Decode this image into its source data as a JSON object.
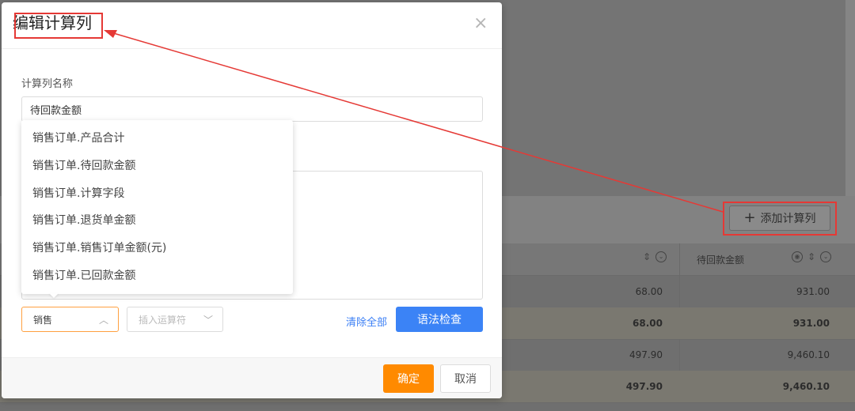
{
  "modal": {
    "title": "编辑计算列",
    "close_label": "×",
    "name_label": "计算列名称",
    "name_value": "待回款金额",
    "dropdown_items": [
      "销售订单.产品合计",
      "销售订单.待回款金额",
      "销售订单.计算字段",
      "销售订单.退货单金额",
      "销售订单.销售订单金额(元)",
      "销售订单.已回款金额"
    ],
    "select_sales": "销售",
    "select_ops_placeholder": "插入运算符",
    "clear_all": "清除全部",
    "syntax_check": "语法检查",
    "ok": "确定",
    "cancel": "取消"
  },
  "background": {
    "add_column_button": "添加计算列",
    "column_header": "待回款金额",
    "rows": [
      {
        "col1": "68.00",
        "col2": "931.00",
        "bold": false
      },
      {
        "col1": "68.00",
        "col2": "931.00",
        "bold": true
      },
      {
        "col1": "497.90",
        "col2": "9,460.10",
        "bold": false
      },
      {
        "col1": "497.90",
        "col2": "9,460.10",
        "bold": true
      }
    ]
  },
  "colors": {
    "primary": "#3b83f6",
    "ok": "#ff8a00",
    "annotation": "#e53935"
  }
}
